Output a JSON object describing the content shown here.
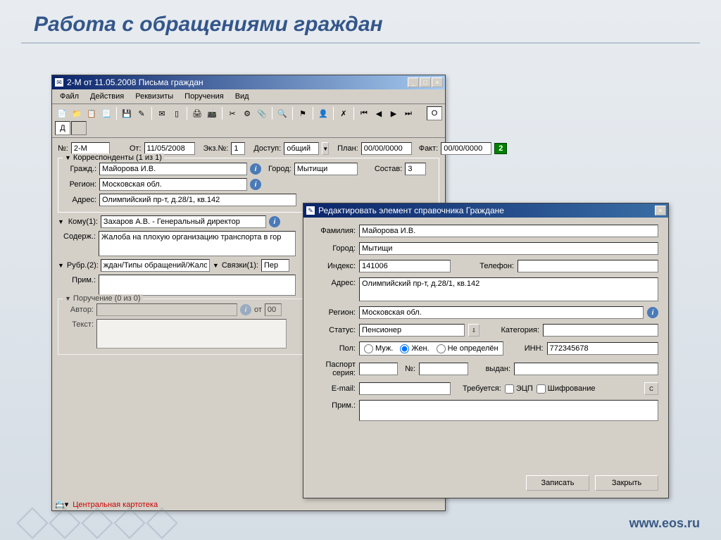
{
  "slide": {
    "title": "Работа с обращениями граждан",
    "footer_url": "www.eos.ru"
  },
  "main": {
    "title": "2-М от 11.05.2008 Письма граждан",
    "menu": [
      "Файл",
      "Действия",
      "Реквизиты",
      "Поручения",
      "Вид"
    ],
    "header": {
      "num_label": "№:",
      "num_value": "2-М",
      "from_label": "От:",
      "from_value": "11/05/2008",
      "copy_label": "Экз.№:",
      "copy_value": "1",
      "access_label": "Доступ:",
      "access_value": "общий",
      "plan_label": "План:",
      "plan_value": "00/00/0000",
      "fact_label": "Факт:",
      "fact_value": "00/00/0000",
      "badge": "2"
    },
    "corr": {
      "legend": "Корреспонденты (1 из 1)",
      "citizen_label": "Гражд.:",
      "citizen_value": "Майорова И.В.",
      "city_label": "Город:",
      "city_value": "Мытищи",
      "sostav_label": "Состав:",
      "sostav_value": "3",
      "region_label": "Регион:",
      "region_value": "Московская обл.",
      "address_label": "Адрес:",
      "address_value": "Олимпийский пр-т, д.28/1, кв.142"
    },
    "whom": {
      "label": "Кому(1):",
      "value": "Захаров А.В. - Генеральный директор"
    },
    "content": {
      "label": "Содерж.:",
      "value": "Жалоба на плохую организацию транспорта в гор"
    },
    "rubr": {
      "label": "Рубр.(2):",
      "value": "ждан/Типы обращений/Жалоба",
      "links_label": "Связки(1):",
      "links_value": "Пер"
    },
    "note_label": "Прим.:",
    "assignment": {
      "legend": "Поручение (0 из 0)",
      "author_label": "Автор:",
      "from_label": "от",
      "from_value": "00",
      "text_label": "Текст:"
    },
    "status": "Центральная картотека",
    "nav_O": "О",
    "nav_D": "Д"
  },
  "dialog": {
    "title": "Редактировать элемент справочника Граждане",
    "surname_label": "Фамилия:",
    "surname_value": "Майорова И.В.",
    "city_label": "Город:",
    "city_value": "Мытищи",
    "index_label": "Индекс:",
    "index_value": "141006",
    "phone_label": "Телефон:",
    "phone_value": "",
    "address_label": "Адрес:",
    "address_value": "Олимпийский пр-т, д.28/1, кв.142",
    "region_label": "Регион:",
    "region_value": "Московская обл.",
    "status_label": "Статус:",
    "status_value": "Пенсионер",
    "category_label": "Категория:",
    "category_value": "",
    "gender_label": "Пол:",
    "gender_options": [
      "Муж.",
      "Жен.",
      "Не определён"
    ],
    "gender_selected": "Жен.",
    "inn_label": "ИНН:",
    "inn_value": "772345678",
    "passport_label": "Паспорт серия:",
    "passport_value": "",
    "passport_num_label": "№:",
    "passport_num_value": "",
    "issued_label": "выдан:",
    "issued_value": "",
    "email_label": "E-mail:",
    "email_value": "",
    "requires_label": "Требуется:",
    "eds_label": "ЭЦП",
    "cipher_label": "Шифрование",
    "c_btn": "С",
    "note_label": "Прим.:",
    "note_value": "",
    "save_btn": "Записать",
    "close_btn": "Закрыть"
  }
}
